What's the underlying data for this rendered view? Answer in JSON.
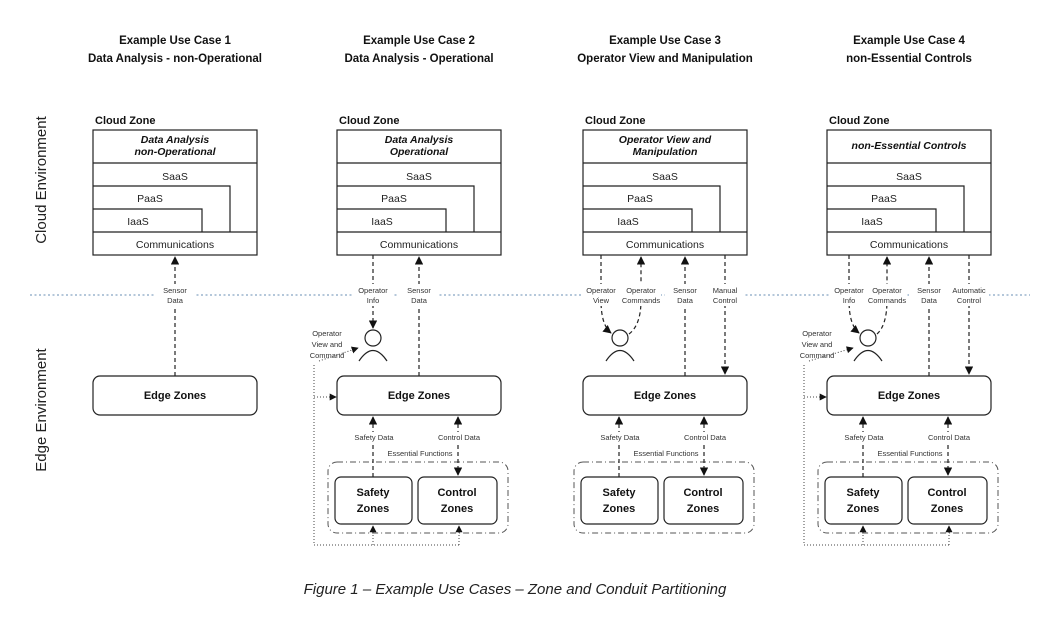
{
  "environments": {
    "cloud": "Cloud Environment",
    "edge": "Edge Environment"
  },
  "colors": {
    "divider": "#6a8fb5",
    "stroke": "#222222"
  },
  "caption": "Figure 1 – Example Use Cases – Zone and Conduit Partitioning",
  "use_cases": [
    {
      "heading": [
        "Example Use Case 1",
        "Data Analysis - non-Operational"
      ],
      "cloud_zone": {
        "label": "Cloud Zone",
        "title": [
          "Data Analysis",
          "non-Operational"
        ],
        "layers": [
          "SaaS",
          "PaaS",
          "IaaS",
          "Communications"
        ]
      },
      "conduits": [
        {
          "label": [
            "Sensor",
            "Data"
          ],
          "direction": "up"
        }
      ],
      "operator": null,
      "edge_zone": "Edge Zones",
      "essential": null
    },
    {
      "heading": [
        "Example Use Case 2",
        "Data Analysis - Operational"
      ],
      "cloud_zone": {
        "label": "Cloud Zone",
        "title": [
          "Data Analysis",
          "Operational"
        ],
        "layers": [
          "SaaS",
          "PaaS",
          "IaaS",
          "Communications"
        ]
      },
      "conduits": [
        {
          "label": [
            "Operator",
            "Info"
          ],
          "direction": "down-to-operator"
        },
        {
          "label": [
            "Sensor",
            "Data"
          ],
          "direction": "up"
        }
      ],
      "operator": {
        "side_label": [
          "Operator",
          "View and",
          "Command"
        ]
      },
      "edge_zone": "Edge Zones",
      "essential": {
        "label": "Essential Functions",
        "safety_data": "Safety Data",
        "control_data": "Control Data",
        "safety_zone": [
          "Safety",
          "Zones"
        ],
        "control_zone": [
          "Control",
          "Zones"
        ]
      }
    },
    {
      "heading": [
        "Example Use Case 3",
        "Operator View and Manipulation"
      ],
      "cloud_zone": {
        "label": "Cloud Zone",
        "title": [
          "Operator View and",
          "Manipulation"
        ],
        "layers": [
          "SaaS",
          "PaaS",
          "IaaS",
          "Communications"
        ]
      },
      "conduits": [
        {
          "label": [
            "Operator",
            "View"
          ],
          "direction": "down-to-operator"
        },
        {
          "label": [
            "Operator",
            "Commands"
          ],
          "direction": "up-from-operator"
        },
        {
          "label": [
            "Sensor",
            "Data"
          ],
          "direction": "up"
        },
        {
          "label": [
            "Manual",
            "Control"
          ],
          "direction": "down"
        }
      ],
      "operator": {
        "side_label": null
      },
      "edge_zone": "Edge Zones",
      "essential": {
        "label": "Essential Functions",
        "safety_data": "Safety Data",
        "control_data": "Control Data",
        "safety_zone": [
          "Safety",
          "Zones"
        ],
        "control_zone": [
          "Control",
          "Zones"
        ]
      }
    },
    {
      "heading": [
        "Example Use Case 4",
        "non-Essential Controls"
      ],
      "cloud_zone": {
        "label": "Cloud Zone",
        "title": [
          "non-Essential Controls"
        ],
        "layers": [
          "SaaS",
          "PaaS",
          "IaaS",
          "Communications"
        ]
      },
      "conduits": [
        {
          "label": [
            "Operator",
            "Info"
          ],
          "direction": "down-to-operator"
        },
        {
          "label": [
            "Operator",
            "Commands"
          ],
          "direction": "up-from-operator"
        },
        {
          "label": [
            "Sensor",
            "Data"
          ],
          "direction": "up"
        },
        {
          "label": [
            "Automatic",
            "Control"
          ],
          "direction": "down"
        }
      ],
      "operator": {
        "side_label": [
          "Operator",
          "View and",
          "Command"
        ]
      },
      "edge_zone": "Edge Zones",
      "essential": {
        "label": "Essential Functions",
        "safety_data": "Safety Data",
        "control_data": "Control Data",
        "safety_zone": [
          "Safety",
          "Zones"
        ],
        "control_zone": [
          "Control",
          "Zones"
        ]
      }
    }
  ]
}
